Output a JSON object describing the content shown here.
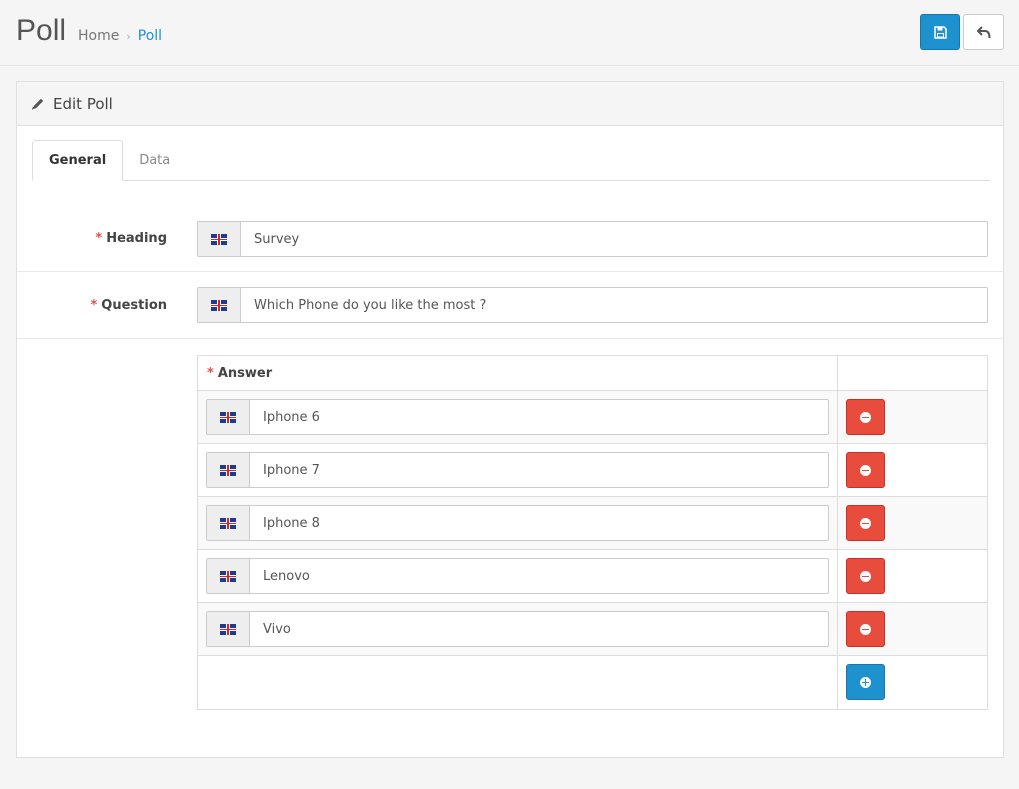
{
  "header": {
    "title": "Poll",
    "breadcrumb": {
      "home": "Home",
      "separator": "›",
      "current": "Poll"
    }
  },
  "panel": {
    "title": "Edit Poll",
    "tabs": [
      {
        "label": "General",
        "active": true
      },
      {
        "label": "Data",
        "active": false
      }
    ]
  },
  "form": {
    "required_mark": "*",
    "heading": {
      "label": "Heading",
      "value": "Survey"
    },
    "question": {
      "label": "Question",
      "value": "Which Phone do you like the most ?"
    },
    "answers": {
      "label": "Answer",
      "items": [
        {
          "value": "Iphone 6"
        },
        {
          "value": "Iphone 7"
        },
        {
          "value": "Iphone 8"
        },
        {
          "value": "Lenovo"
        },
        {
          "value": "Vivo"
        }
      ]
    }
  },
  "colors": {
    "primary": "#1e91cf",
    "danger": "#e74c3c",
    "required": "#d9534f"
  },
  "icons": {
    "save": "floppy-disk-icon",
    "back": "reply-arrow-icon",
    "edit": "pencil-icon",
    "language": "uk-flag-icon",
    "remove": "minus-circle-icon",
    "add": "plus-circle-icon"
  }
}
